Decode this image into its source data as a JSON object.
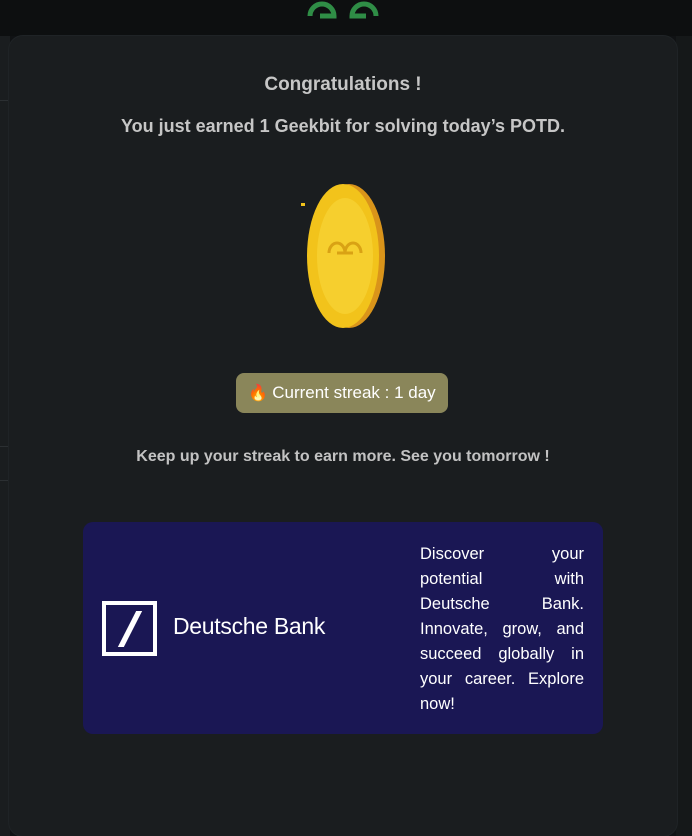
{
  "modal": {
    "title": "Congratulations !",
    "subtitle": "You just earned 1 Geekbit for solving today’s POTD.",
    "streak": {
      "icon": "flame-icon",
      "label": "Current streak : 1 day"
    },
    "encouragement": "Keep up your streak to earn more. See you tomorrow !"
  },
  "ad": {
    "brand": "Deutsche Bank",
    "text": "Discover your potential with Deutsche Bank. Innovate, grow, and succeed globally in your career. Explore now!",
    "background": "#1a1754"
  },
  "colors": {
    "modal_bg": "#1a1d1f",
    "streak_bg": "#8a865a",
    "coin": "#f2c31b",
    "brand_green": "#2f8d46"
  }
}
